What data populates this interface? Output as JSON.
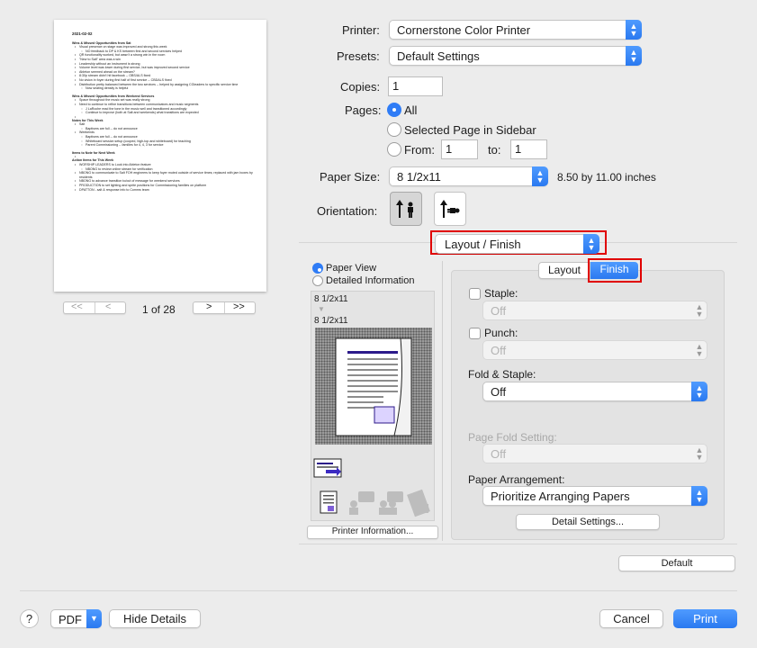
{
  "preview": {
    "date": "2021-02-02",
    "sections": [
      {
        "title": "Wins & Missed Opportunities from Sat",
        "lines": [
          [
            "b",
            "Visual presence on stage was improved and strong this week"
          ],
          [
            "c",
            "NO feedback to DP & KS between first and second services helped"
          ],
          [
            "b",
            "QR functionality worked, but wasn't a strong win in the room"
          ],
          [
            "b",
            "\"New to Salt\" area was a win"
          ],
          [
            "b",
            "Leadership without an instrument is strong"
          ],
          [
            "b",
            "Volume level was lower during first service, but was improved second service"
          ],
          [
            "b",
            "Ableton seemed ahead on the stream?"
          ],
          [
            "b",
            "8:30p stream didn't hit facebook -- OBS/ALS fixed"
          ],
          [
            "b",
            "No vision in foyer during first half of first service -- CBDALS fixed"
          ],
          [
            "b",
            "Distribution pretty balanced between the two services -- helped by assigning CGleaders to specific service time"
          ],
          [
            "c",
            "Now seating density is helpful"
          ]
        ]
      },
      {
        "title": "Wins & Missed Opportunities from Weekend Services",
        "lines": [
          [
            "b",
            "Space throughout the music set was really strong"
          ],
          [
            "b",
            "Need to continue to refine transitions between communicators and music segments"
          ],
          [
            "c",
            "J LaRoche read the tone in the music well and transitioned accordingly"
          ],
          [
            "c",
            "Continue to improve (both at Salt and weekends) what transitions are expected"
          ],
          [
            "b",
            ""
          ]
        ]
      },
      {
        "title": "Notes for This Week",
        "lines": [
          [
            "b",
            "Salt"
          ],
          [
            "c",
            "Baptisms are full -- do not announce"
          ],
          [
            "b",
            "Weekends"
          ],
          [
            "c",
            "Baptisms are full -- do not announce"
          ],
          [
            "c",
            "Whiteboard session setup (cooped, high-top and whiteboard) for teaching"
          ],
          [
            "c",
            "Parent Commissioning -- families for 4, 4, 3 for service"
          ]
        ]
      },
      {
        "title": "Items to Note for Next Week",
        "lines": [
          [
            "b",
            ""
          ]
        ]
      },
      {
        "title": "Action Items for This Week",
        "lines": [
          [
            "b",
            "WORSHIP LEADERS to Look into Ableton feature"
          ],
          [
            "c",
            "NBONG to review online stream for verification"
          ],
          [
            "b",
            "NBONG to communicate to Salt FOH engineers to keep foyer muted outside of service times; replaced with jam boxes by residents"
          ],
          [
            "b",
            "NBONG to advance transition to/out of message for weekend services"
          ],
          [
            "b",
            "PRODUCTION to set lighting and sprite positions for Commissioning families on platform"
          ],
          [
            "b",
            "DPATTON - salt & response info to Comms team"
          ]
        ]
      }
    ],
    "page_counter": "1 of 28",
    "nav_first": "<<",
    "nav_prev": "<",
    "nav_next": ">",
    "nav_last": ">>"
  },
  "printer": {
    "label": "Printer:",
    "value": "Cornerstone Color Printer"
  },
  "presets": {
    "label": "Presets:",
    "value": "Default Settings"
  },
  "copies": {
    "label": "Copies:",
    "value": "1"
  },
  "pages": {
    "label": "Pages:",
    "all": "All",
    "selected": "Selected Page in Sidebar",
    "from_label": "From:",
    "from_value": "1",
    "to_label": "to:",
    "to_value": "1"
  },
  "paper_size": {
    "label": "Paper Size:",
    "value": "8 1/2x11",
    "dims": "8.50 by 11.00 inches"
  },
  "orientation": {
    "label": "Orientation:"
  },
  "section_popup": {
    "value": "Layout / Finish"
  },
  "left_panel": {
    "paper_view": "Paper View",
    "detailed_info": "Detailed Information",
    "size_top": "8 1/2x11",
    "size_bottom": "8 1/2x11",
    "printer_info_button": "Printer Information..."
  },
  "tabs": {
    "layout": "Layout",
    "finish": "Finish"
  },
  "finish": {
    "staple_label": "Staple:",
    "staple_value": "Off",
    "punch_label": "Punch:",
    "punch_value": "Off",
    "fold_staple_label": "Fold & Staple:",
    "fold_staple_value": "Off",
    "page_fold_label": "Page Fold Setting:",
    "page_fold_value": "Off",
    "arrangement_label": "Paper Arrangement:",
    "arrangement_value": "Prioritize Arranging Papers",
    "detail_button": "Detail Settings..."
  },
  "default_button": "Default",
  "footer": {
    "help": "?",
    "pdf": "PDF",
    "hide_details": "Hide Details",
    "cancel": "Cancel",
    "print": "Print"
  },
  "colors": {
    "accent": "#2f7cf6",
    "highlight_box": "#e00000"
  }
}
